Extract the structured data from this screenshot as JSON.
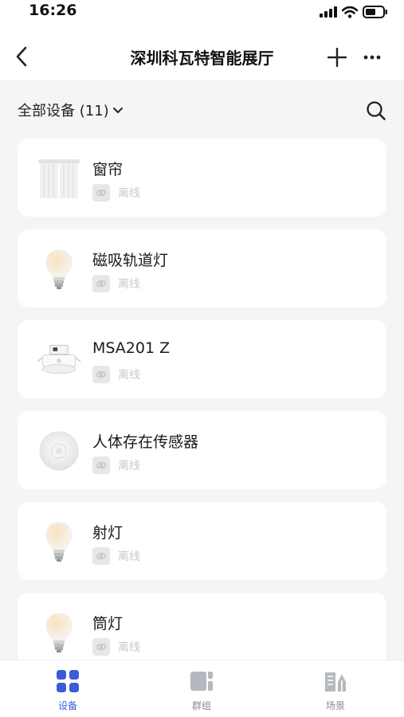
{
  "status_bar": {
    "time": "16:26"
  },
  "nav": {
    "title": "深圳科瓦特智能展厅"
  },
  "filter": {
    "label": "全部设备 (11)"
  },
  "devices": [
    {
      "name": "窗帘",
      "status": "离线",
      "icon": "curtain-icon"
    },
    {
      "name": "磁吸轨道灯",
      "status": "离线",
      "icon": "bulb-icon"
    },
    {
      "name": "MSA201 Z",
      "status": "离线",
      "icon": "ceiling-sensor-icon"
    },
    {
      "name": "人体存在传感器",
      "status": "离线",
      "icon": "presence-sensor-icon"
    },
    {
      "name": "射灯",
      "status": "离线",
      "icon": "bulb-icon"
    },
    {
      "name": "筒灯",
      "status": "离线",
      "icon": "bulb-icon"
    }
  ],
  "tabs": [
    {
      "label": "设备",
      "icon": "grid-icon",
      "active": true
    },
    {
      "label": "群组",
      "icon": "group-icon",
      "active": false
    },
    {
      "label": "场景",
      "icon": "scene-icon",
      "active": false
    }
  ],
  "colors": {
    "accent": "#3b5bdb",
    "background": "#f5f5f7",
    "offline_text": "#c9c9cc"
  }
}
